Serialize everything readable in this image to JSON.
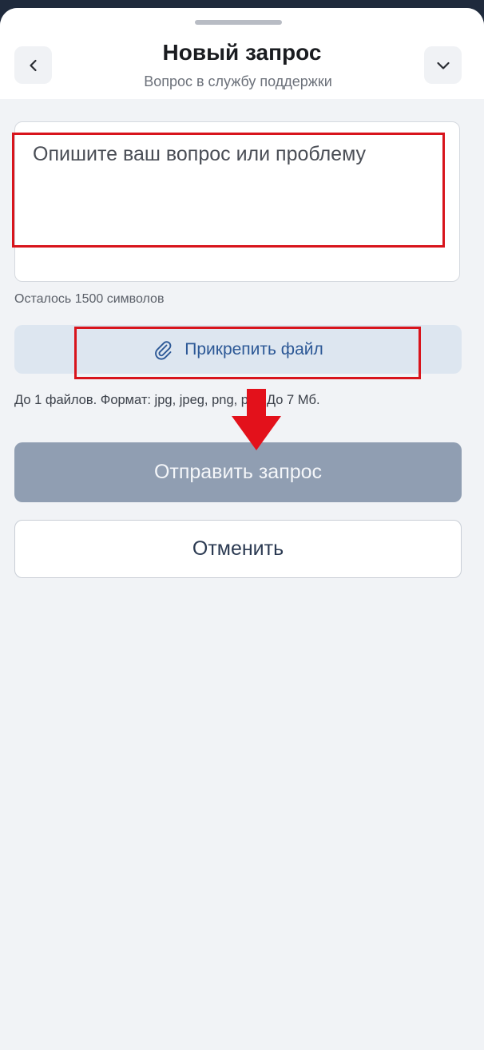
{
  "header": {
    "title": "Новый запрос",
    "subtitle": "Вопрос в службу поддержки",
    "back_icon": "chevron-left-icon",
    "collapse_icon": "chevron-down-icon"
  },
  "form": {
    "message_placeholder": "Опишите ваш вопрос или проблему",
    "chars_left": "Осталось 1500 символов",
    "attach_label": "Прикрепить файл",
    "attach_icon": "paperclip-icon",
    "attach_hint": "До 1 файлов. Формат: jpg, jpeg, png, pdf. До 7 Мб."
  },
  "actions": {
    "submit_label": "Отправить запрос",
    "cancel_label": "Отменить"
  },
  "annotations": {
    "highlight_color": "#d8141c",
    "arrow_icon": "arrow-down-icon"
  },
  "colors": {
    "accent_text": "#2c5896",
    "attach_bg": "#dde6f0",
    "submit_bg": "#909eb2",
    "page_bg": "#f1f3f6"
  }
}
